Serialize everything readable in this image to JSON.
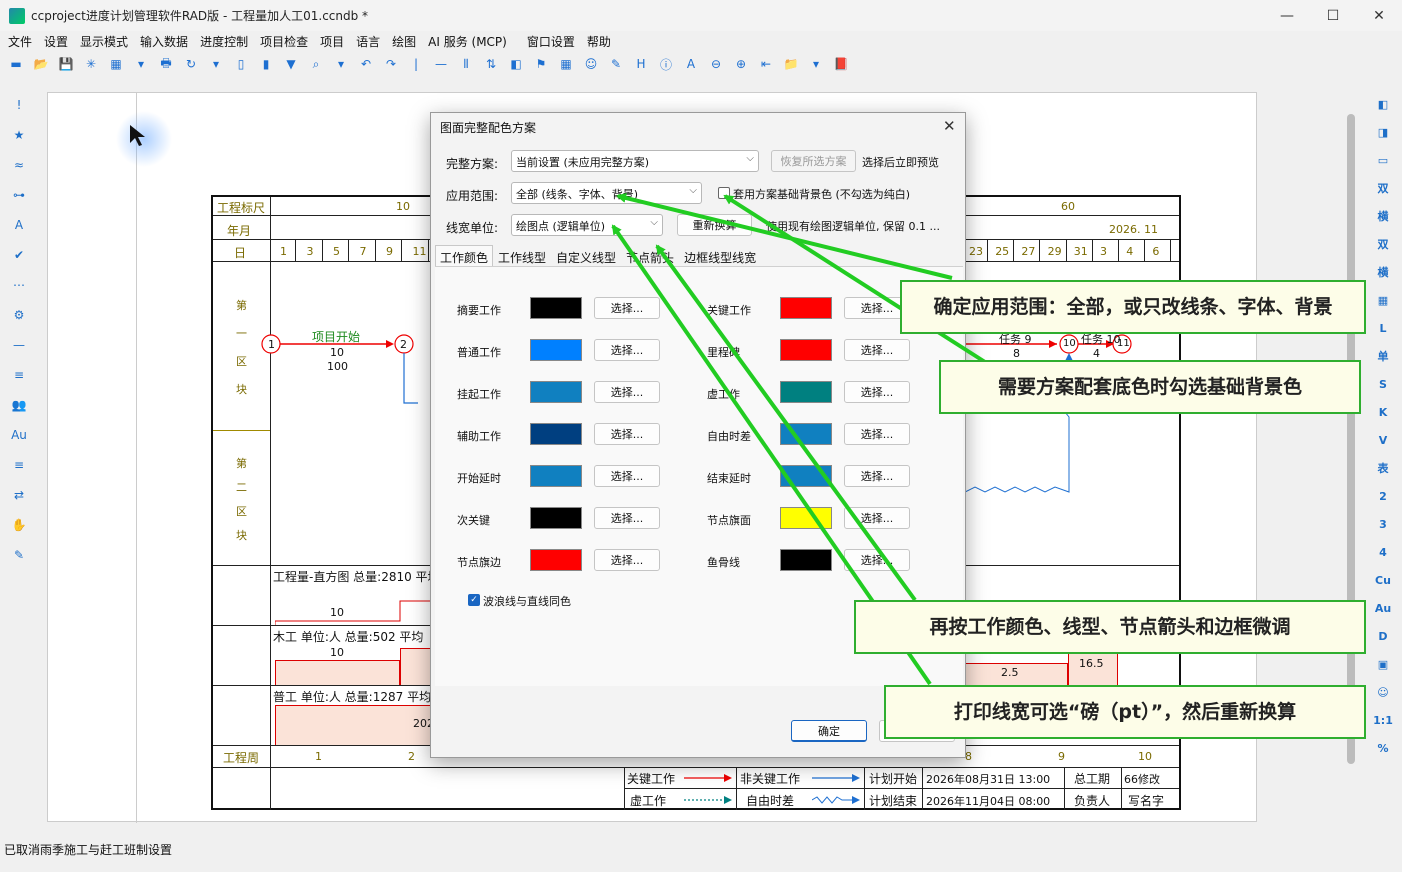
{
  "window": {
    "title": "ccproject进度计划管理软件RAD版 - 工程量加人工01.ccndb *",
    "min": "—",
    "max": "☐",
    "close": "✕"
  },
  "menu": [
    "文件",
    "设置",
    "显示模式",
    "输入数据",
    "进度控制",
    "项目检查",
    "项目",
    "语言",
    "绘图",
    "AI 服务 (MCP)",
    "窗口设置",
    "帮助"
  ],
  "toolbar": [
    "▬",
    "📂",
    "💾",
    "✳",
    "▦",
    "▾",
    "🖶",
    "↻",
    "▾",
    "▯",
    "▮",
    "▼",
    "⌕",
    "▾",
    "↶",
    "↷",
    "|",
    "—",
    "⫴",
    "⇅",
    "◧",
    "⚑",
    "▦",
    "☺",
    "✎",
    "H",
    "ⓘ",
    "A",
    "⊖",
    "⊕",
    "⇤",
    "📁",
    "▾",
    "📕"
  ],
  "lefttool": [
    "!",
    "★",
    "≈",
    "⊶",
    "A",
    "✔",
    "⋯",
    "⚙",
    "—",
    "≡",
    "👥",
    "Au",
    "≡",
    "⇄",
    "✋",
    "✎"
  ],
  "righttool": [
    "◧",
    "◨",
    "▭",
    "双",
    "横",
    "双",
    "横",
    "▦",
    "L",
    "单",
    "S",
    "K",
    "V",
    "表",
    "2",
    "3",
    "4",
    "Cu",
    "Au",
    "D",
    "▣",
    "☺",
    "1:1",
    "%"
  ],
  "gantt": {
    "ruler_label": "工程标尺",
    "ruler_ticks": [
      "10",
      "60"
    ],
    "month_label": "年月",
    "month_value": "2026. 11",
    "day_label": "日",
    "days_left": [
      "1",
      "3",
      "5",
      "7",
      "9",
      "11"
    ],
    "days_right": [
      "23",
      "25",
      "27",
      "29",
      "31",
      "3",
      "4",
      "6"
    ],
    "block1": [
      "第",
      "一",
      "区",
      "块"
    ],
    "block2": [
      "第",
      "二",
      "区",
      "块"
    ],
    "task_start": "项目开始",
    "task_start_dur": "10",
    "task_start_qty": "100",
    "node1": "1",
    "node2": "2",
    "node10": "10",
    "node11": "11",
    "task_r1": "任务 9",
    "task_r1_dur": "8",
    "task_r2": "任务 10",
    "task_r2_dur": "4",
    "hist1_title": "工程量-直方图 总量:2810 平均",
    "hist1_val": "10",
    "hist2_title": "木工 单位:人 总量:502 平均",
    "hist2_val": "10",
    "hist2_r1": "2.5",
    "hist2_r2": "16.5",
    "hist3_title": "普工 单位:人 总量:1287 平均",
    "hist3_val": "202",
    "week_label": "工程周",
    "weeks": [
      "1",
      "2",
      "8",
      "9",
      "10"
    ],
    "legend": {
      "critical": "关键工作",
      "noncritical": "非关键工作",
      "plan_start": "计划开始",
      "plan_start_val": "2026年08月31日  13:00",
      "total": "总工期",
      "total_val": "66修改",
      "dummy": "虚工作",
      "float": "自由时差",
      "plan_end": "计划结束",
      "plan_end_val": "2026年11月04日  08:00",
      "owner": "负责人",
      "owner_val": "写名字"
    }
  },
  "status": "已取消雨季施工与赶工班制设置",
  "dialog": {
    "title": "图面完整配色方案",
    "close": "✕",
    "scheme_label": "完整方案:",
    "scheme_value": "当前设置 (未应用完整方案)",
    "restore_btn": "恢复所选方案",
    "preview_text": "选择后立即预览",
    "scope_label": "应用范围:",
    "scope_value": "全部 (线条、字体、背景)",
    "bg_check": "套用方案基础背景色 (不勾选为纯白)",
    "width_label": "线宽单位:",
    "width_value": "绘图点 (逻辑单位)",
    "reconvert_btn": "重新换算",
    "width_note": "使用现有绘图逻辑单位, 保留 0.1 ...",
    "tabs": [
      "工作颜色",
      "工作线型",
      "自定义线型",
      "节点箭头",
      "边框线型线宽"
    ],
    "select_label": "选择...",
    "colors_left": [
      {
        "name": "摘要工作",
        "color": "#000000"
      },
      {
        "name": "普通工作",
        "color": "#0080ff"
      },
      {
        "name": "挂起工作",
        "color": "#1080c0"
      },
      {
        "name": "辅助工作",
        "color": "#003f80"
      },
      {
        "name": "开始延时",
        "color": "#1080c0"
      },
      {
        "name": "次关键",
        "color": "#000000"
      },
      {
        "name": "节点旗边",
        "color": "#ff0000"
      }
    ],
    "colors_right": [
      {
        "name": "关键工作",
        "color": "#ff0000"
      },
      {
        "name": "里程碑",
        "color": "#ff0000"
      },
      {
        "name": "虚工作",
        "color": "#008080"
      },
      {
        "name": "自由时差",
        "color": "#1080c0"
      },
      {
        "name": "结束延时",
        "color": "#1080c0"
      },
      {
        "name": "节点旗面",
        "color": "#ffff00"
      },
      {
        "name": "鱼骨线",
        "color": "#000000"
      }
    ],
    "wave_check": "波浪线与直线同色",
    "ok_btn": "确定"
  },
  "callouts": [
    "确定应用范围：全部，或只改线条、字体、背景",
    "需要方案配套底色时勾选基础背景色",
    "再按工作颜色、线型、节点箭头和边框微调",
    "打印线宽可选“磅（pt）”，然后重新换算"
  ],
  "colors": {
    "callout_border": "#2fae2f",
    "arrow": "#22cc22",
    "critical": "#ff0000",
    "normal": "#1e6fd1"
  }
}
